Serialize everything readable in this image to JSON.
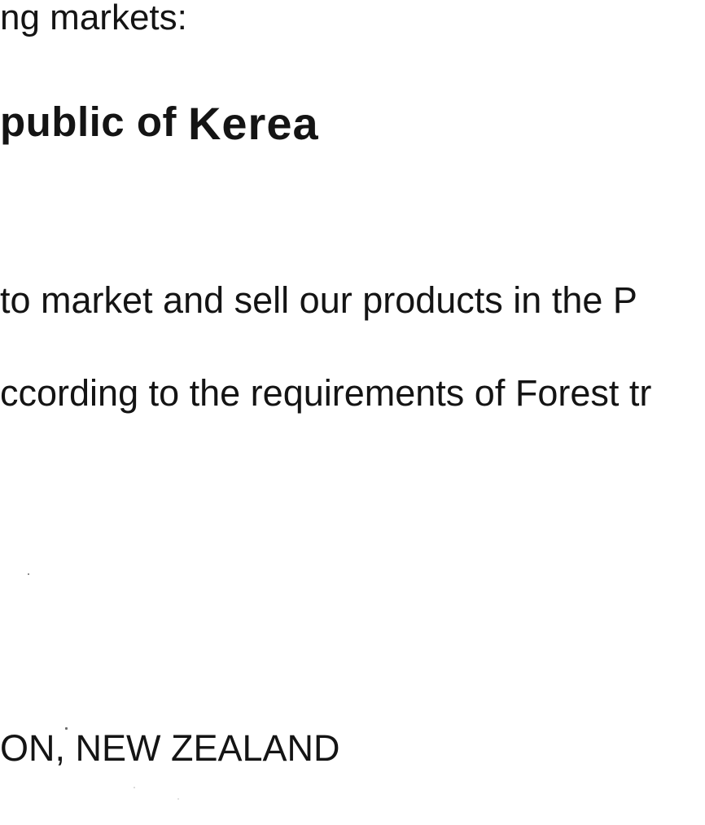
{
  "document": {
    "line_markets": "ng markets:",
    "heading": {
      "part_a": "public of",
      "part_b": "Kerea"
    },
    "line_market_sell": "to market and sell our products in the P",
    "line_according": "ccording to the requirements of Forest  tr",
    "line_zealand": "ON, NEW ZEALAND"
  }
}
